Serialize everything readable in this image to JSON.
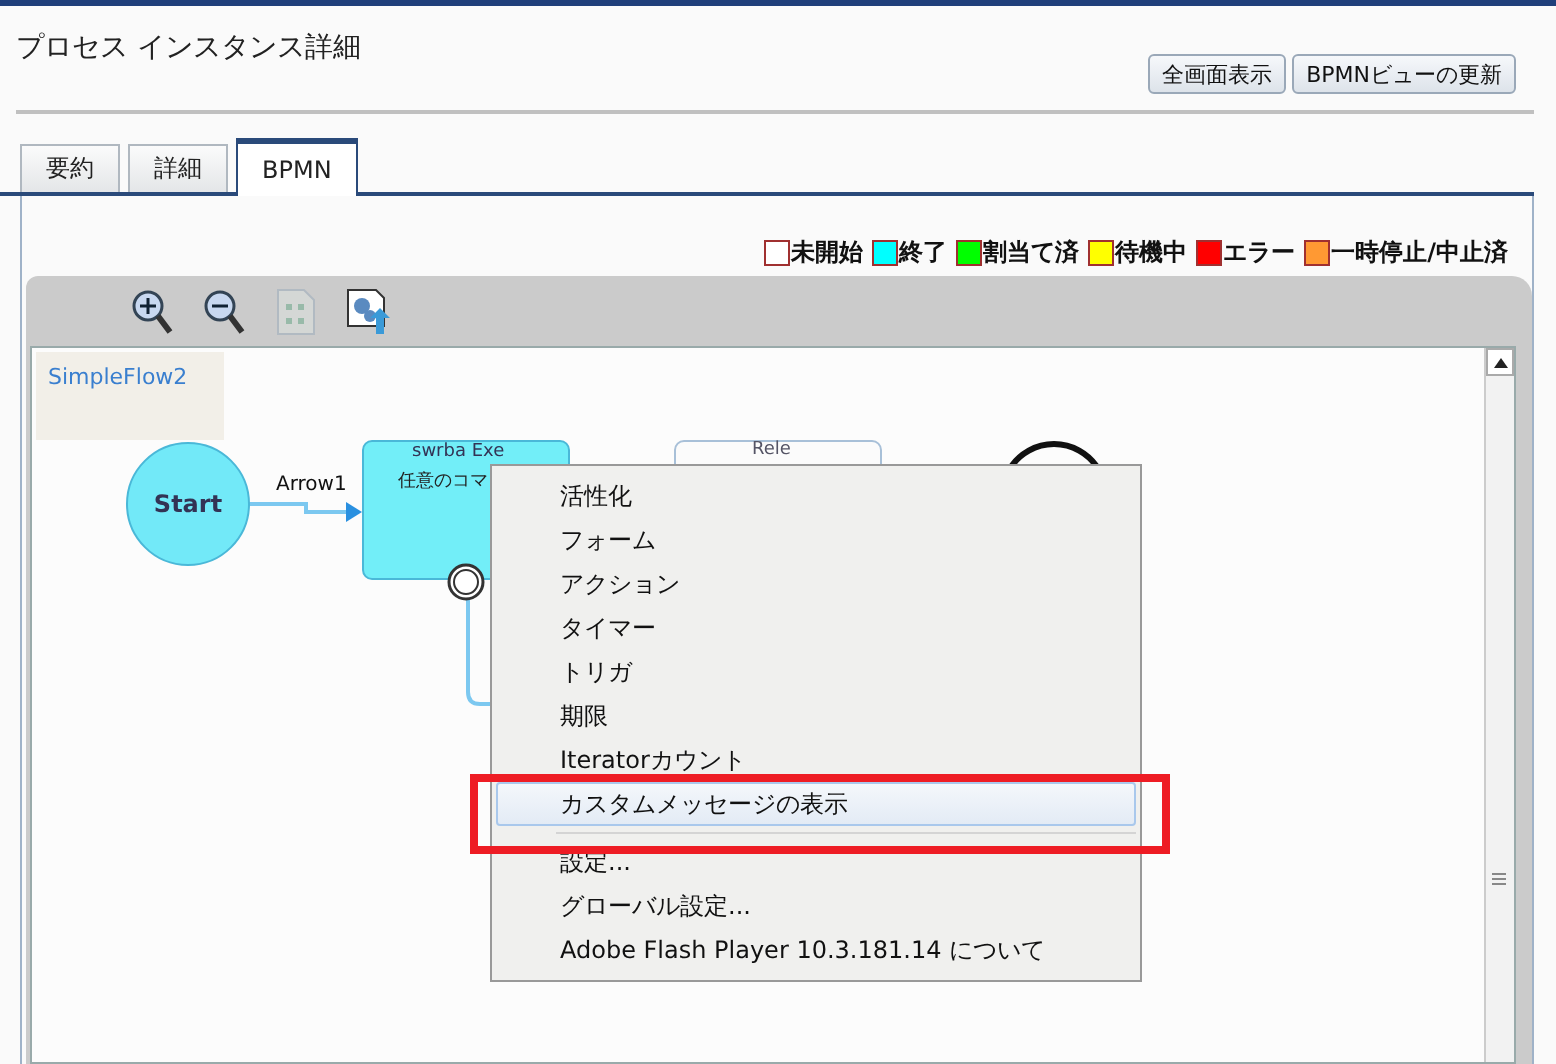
{
  "header": {
    "title": "プロセス インスタンス詳細",
    "buttons": [
      "全画面表示",
      "BPMNビューの更新"
    ]
  },
  "tabs": [
    {
      "label": "要約",
      "selected": false
    },
    {
      "label": "詳細",
      "selected": false
    },
    {
      "label": "BPMN",
      "selected": true
    }
  ],
  "legend": [
    {
      "label": "未開始",
      "color": "#ffffff"
    },
    {
      "label": "終了",
      "color": "#00ffff"
    },
    {
      "label": "割当て済",
      "color": "#00ff00"
    },
    {
      "label": "待機中",
      "color": "#ffff00"
    },
    {
      "label": "エラー",
      "color": "#ff0000"
    },
    {
      "label": "一時停止/中止済",
      "color": "#ff9933"
    }
  ],
  "toolbar": [
    {
      "kind": "zoom-in",
      "disabled": false
    },
    {
      "kind": "zoom-out",
      "disabled": false
    },
    {
      "kind": "fit",
      "disabled": true
    },
    {
      "kind": "export",
      "disabled": false
    }
  ],
  "diagram": {
    "process_name": "SimpleFlow2",
    "start": {
      "label": "Start"
    },
    "arrow": {
      "label": "Arrow1"
    },
    "task": {
      "line_1": "swrba Exe",
      "line_2": "任意のコマ"
    },
    "task_2": {
      "label": "Rele"
    }
  },
  "context_menu": {
    "items": [
      {
        "label": "活性化",
        "highlighted": false
      },
      {
        "label": "フォーム",
        "highlighted": false
      },
      {
        "label": "アクション",
        "highlighted": false
      },
      {
        "label": "タイマー",
        "highlighted": false
      },
      {
        "label": "トリガ",
        "highlighted": false
      },
      {
        "label": "期限",
        "highlighted": false
      },
      {
        "label": "Iteratorカウント",
        "highlighted": false
      },
      {
        "label": "カスタムメッセージの表示",
        "highlighted": true
      },
      {
        "label": "設定...",
        "highlighted": false,
        "separator_before": true
      },
      {
        "label": "グローバル設定...",
        "highlighted": false
      },
      {
        "label": "Adobe Flash Player 10.3.181.14  について",
        "highlighted": false
      }
    ]
  }
}
